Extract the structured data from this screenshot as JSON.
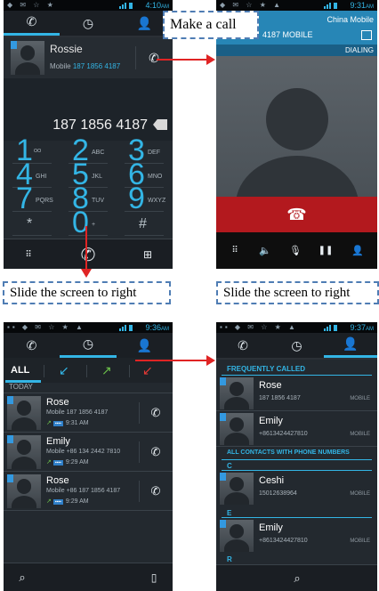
{
  "captions": {
    "make_call": "Make a call",
    "slide_left": "Slide the screen to right",
    "slide_right": "Slide the screen to right"
  },
  "dialer": {
    "status_time": "4:10",
    "status_ampm": "AM",
    "suggestion": {
      "name": "Rossie",
      "number_label": "Mobile",
      "number": "187 1856 4187"
    },
    "entered_number": "187 1856 4187",
    "keys": [
      {
        "digit": "1",
        "letters": ""
      },
      {
        "digit": "2",
        "letters": "ABC"
      },
      {
        "digit": "3",
        "letters": "DEF"
      },
      {
        "digit": "4",
        "letters": "GHI"
      },
      {
        "digit": "5",
        "letters": "JKL"
      },
      {
        "digit": "6",
        "letters": "MNO"
      },
      {
        "digit": "7",
        "letters": "PQRS"
      },
      {
        "digit": "8",
        "letters": "TUV"
      },
      {
        "digit": "9",
        "letters": "WXYZ"
      },
      {
        "digit": "*",
        "letters": ""
      },
      {
        "digit": "0",
        "letters": "+"
      },
      {
        "digit": "#",
        "letters": ""
      }
    ]
  },
  "incall": {
    "status_time": "9:31",
    "status_ampm": "AM",
    "number_partial": "4187 MOBILE",
    "carrier": "China Mobile",
    "state": "DIALING"
  },
  "calllog": {
    "status_time": "9:36",
    "status_ampm": "AM",
    "filter_all": "ALL",
    "section": "TODAY",
    "entries": [
      {
        "name": "Rose",
        "label": "Mobile",
        "number": "187 1856 4187",
        "time": "9:31 AM"
      },
      {
        "name": "Emily",
        "label": "Mobile",
        "number": "+86 134 2442 7810",
        "time": "9:29 AM"
      },
      {
        "name": "Rose",
        "label": "Mobile",
        "number": "+86 187 1856 4187",
        "time": "9:29 AM"
      }
    ]
  },
  "contacts": {
    "status_time": "9:37",
    "status_ampm": "AM",
    "frequent_header": "FREQUENTLY CALLED",
    "frequent": [
      {
        "name": "Rose",
        "number": "187 1856 4187",
        "type": "MOBILE"
      },
      {
        "name": "Emily",
        "number": "+8613424427810",
        "type": "MOBILE"
      }
    ],
    "all_header": "ALL CONTACTS WITH PHONE NUMBERS",
    "letter_c": "C",
    "letter_e": "E",
    "letter_r": "R",
    "all": [
      {
        "name": "Ceshi",
        "number": "15012638964",
        "type": "MOBILE"
      },
      {
        "name": "Emily",
        "number": "+8613424427810",
        "type": "MOBILE"
      }
    ]
  },
  "colors": {
    "accent": "#33b5e5",
    "end_call": "#b3191e",
    "arrow": "#e02424"
  }
}
